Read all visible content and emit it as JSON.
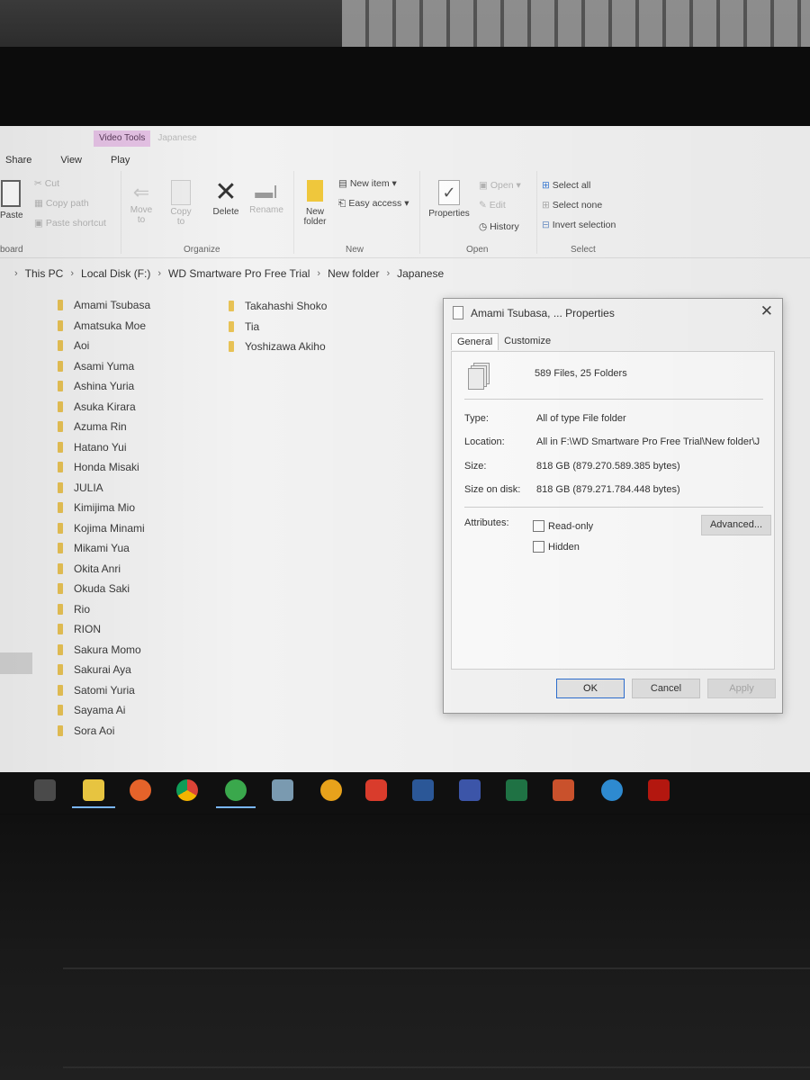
{
  "ribbon": {
    "context_tab": "Video Tools",
    "context_folder": "Japanese",
    "tabs": [
      "Share",
      "View",
      "Play"
    ],
    "clipboard": {
      "cut": "Cut",
      "copy_path": "Copy path",
      "paste": "Paste",
      "paste_shortcut": "Paste shortcut",
      "group": "board"
    },
    "organize": {
      "move_to": "Move to",
      "copy_to": "Copy to",
      "delete": "Delete",
      "rename": "Rename",
      "group": "Organize"
    },
    "new": {
      "new_folder": "New folder",
      "new_item": "New item",
      "easy_access": "Easy access",
      "group": "New"
    },
    "open": {
      "properties": "Properties",
      "open": "Open",
      "edit": "Edit",
      "history": "History",
      "group": "Open"
    },
    "select": {
      "select_all": "Select all",
      "select_none": "Select none",
      "invert_selection": "Invert selection",
      "group": "Select"
    }
  },
  "breadcrumb": [
    "This PC",
    "Local Disk (F:)",
    "WD Smartware Pro Free Trial",
    "New folder",
    "Japanese"
  ],
  "folders_col1": [
    "Amami Tsubasa",
    "Amatsuka Moe",
    "Aoi",
    "Asami Yuma",
    "Ashina Yuria",
    "Asuka Kirara",
    "Azuma Rin",
    "Hatano Yui",
    "Honda Misaki",
    "JULIA",
    "Kimijima Mio",
    "Kojima Minami",
    "Mikami Yua",
    "Okita Anri",
    "Okuda Saki",
    "Rio",
    "RION",
    "Sakura Momo",
    "Sakurai Aya",
    "Satomi Yuria",
    "Sayama Ai",
    "Sora Aoi"
  ],
  "folders_col2": [
    "Takahashi Shoko",
    "Tia",
    "Yoshizawa Akiho"
  ],
  "dialog": {
    "title": "Amami Tsubasa, ... Properties",
    "tabs": [
      "General",
      "Customize"
    ],
    "summary": "589 Files, 25 Folders",
    "type_label": "Type:",
    "type_value": "All of type File folder",
    "location_label": "Location:",
    "location_value": "All in F:\\WD Smartware Pro Free Trial\\New folder\\J",
    "size_label": "Size:",
    "size_value": "818 GB (879.270.589.385 bytes)",
    "size_on_disk_label": "Size on disk:",
    "size_on_disk_value": "818 GB (879.271.784.448 bytes)",
    "attributes_label": "Attributes:",
    "readonly_label": "Read-only",
    "hidden_label": "Hidden",
    "advanced_label": "Advanced...",
    "ok_label": "OK",
    "cancel_label": "Cancel",
    "apply_label": "Apply"
  },
  "taskbar_icons": [
    "store-icon",
    "file-explorer-icon",
    "firefox-icon",
    "chrome-icon",
    "download-manager-icon",
    "media-icon",
    "vlc-like-icon",
    "app-icon",
    "word-icon",
    "visio-icon",
    "excel-icon",
    "powerpoint-icon",
    "network-icon",
    "acrobat-icon"
  ]
}
